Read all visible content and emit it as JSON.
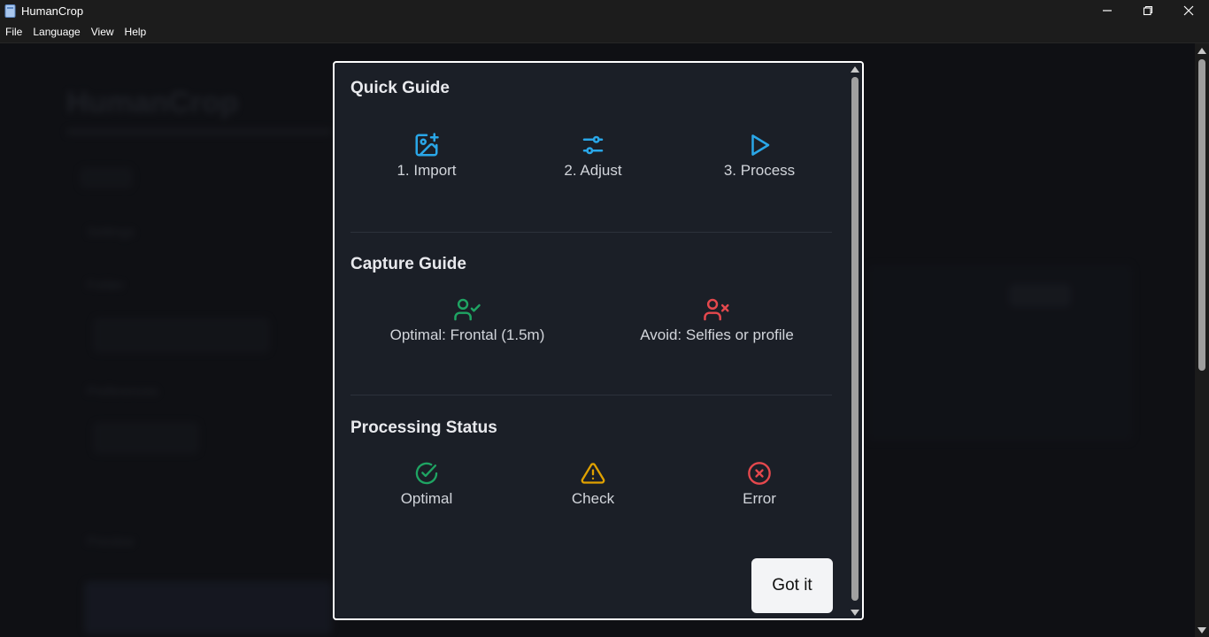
{
  "window": {
    "title": "HumanCrop"
  },
  "menu": {
    "items": [
      "File",
      "Language",
      "View",
      "Help"
    ]
  },
  "background": {
    "heading": "HumanCrop",
    "labels": [
      "Settings",
      "Folder",
      "Preferences",
      "Preview"
    ]
  },
  "modal": {
    "quick_guide": {
      "title": "Quick Guide",
      "steps": [
        {
          "label": "1. Import",
          "icon": "image-plus-icon"
        },
        {
          "label": "2. Adjust",
          "icon": "sliders-icon"
        },
        {
          "label": "3. Process",
          "icon": "play-icon"
        }
      ]
    },
    "capture_guide": {
      "title": "Capture Guide",
      "items": [
        {
          "label": "Optimal: Frontal (1.5m)",
          "icon": "user-check-icon"
        },
        {
          "label": "Avoid: Selfies or profile",
          "icon": "user-x-icon"
        }
      ]
    },
    "processing_status": {
      "title": "Processing Status",
      "items": [
        {
          "label": "Optimal",
          "icon": "check-circle-icon"
        },
        {
          "label": "Check",
          "icon": "warning-triangle-icon"
        },
        {
          "label": "Error",
          "icon": "x-circle-icon"
        }
      ]
    },
    "button_label": "Got it"
  },
  "colors": {
    "accent_blue": "#2aa7e8",
    "success_green": "#1fa463",
    "warning_amber": "#e0a100",
    "error_red": "#e5484d"
  }
}
